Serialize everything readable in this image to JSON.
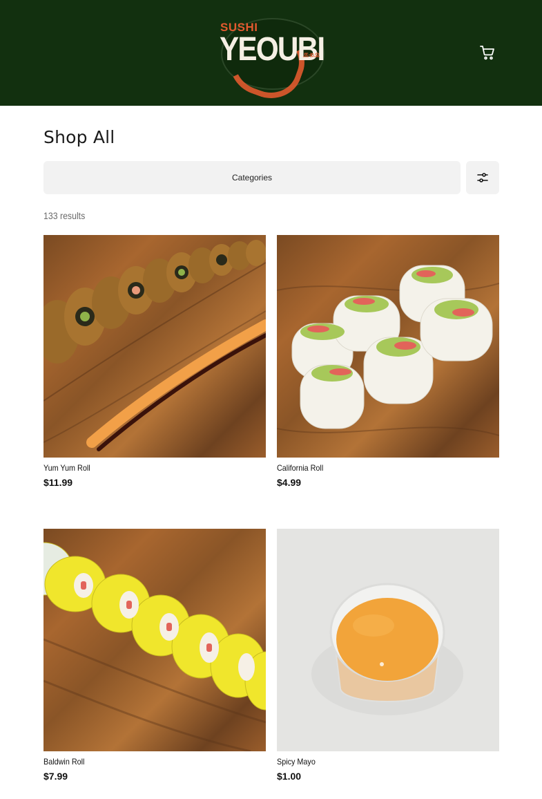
{
  "header": {
    "logo": {
      "top_text": "SUSHI",
      "main_text": "YEOUBI",
      "side_text": "여우비"
    },
    "cart_icon": "cart-icon"
  },
  "shop": {
    "title": "Shop All",
    "categories_label": "Categories",
    "filter_icon": "sliders-icon",
    "results_text": "133 results"
  },
  "products": [
    {
      "name": "Yum Yum Roll",
      "price": "$11.99"
    },
    {
      "name": "California Roll",
      "price": "$4.99"
    },
    {
      "name": "Baldwin Roll",
      "price": "$7.99"
    },
    {
      "name": "Spicy Mayo",
      "price": "$1.00"
    }
  ],
  "colors": {
    "header_bg": "#12300f",
    "accent": "#e35a2f",
    "button_bg": "#f2f2f2"
  }
}
